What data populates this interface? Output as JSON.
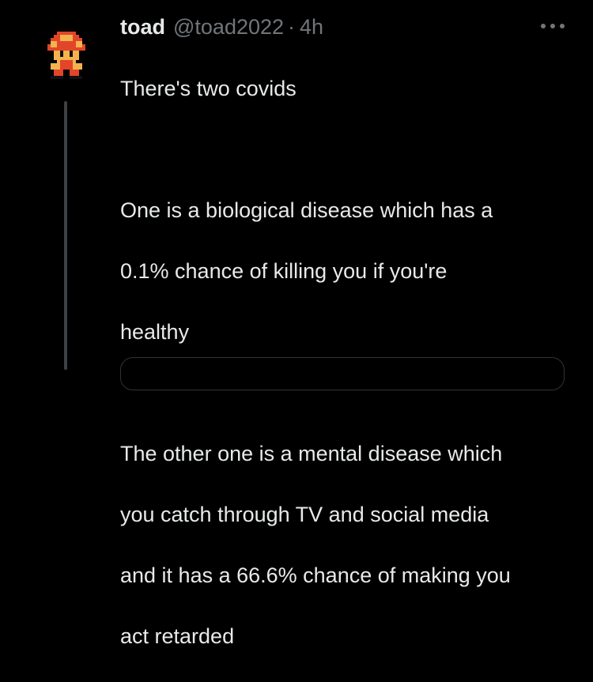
{
  "tweet": {
    "name": "toad",
    "handle": "@toad2022",
    "separator": "·",
    "time": "4h",
    "text_lines": [
      "There's two covids",
      "",
      "One is a biological disease which has a",
      "0.1% chance of killing you if you're",
      "healthy",
      "",
      "The other one is a mental disease which",
      "you catch through TV and social media",
      "and it has a 66.6% chance of making you",
      "act retarded"
    ],
    "avatar_icon": "toad-pixel-avatar-icon",
    "more_icon": "more-options-icon"
  },
  "colors": {
    "background": "#000000",
    "primary_text": "#e7e9ea",
    "secondary_text": "#71767b",
    "thread_line": "#3e4144",
    "avatar_red": "#e2452a",
    "avatar_skin": "#f4b24d"
  }
}
